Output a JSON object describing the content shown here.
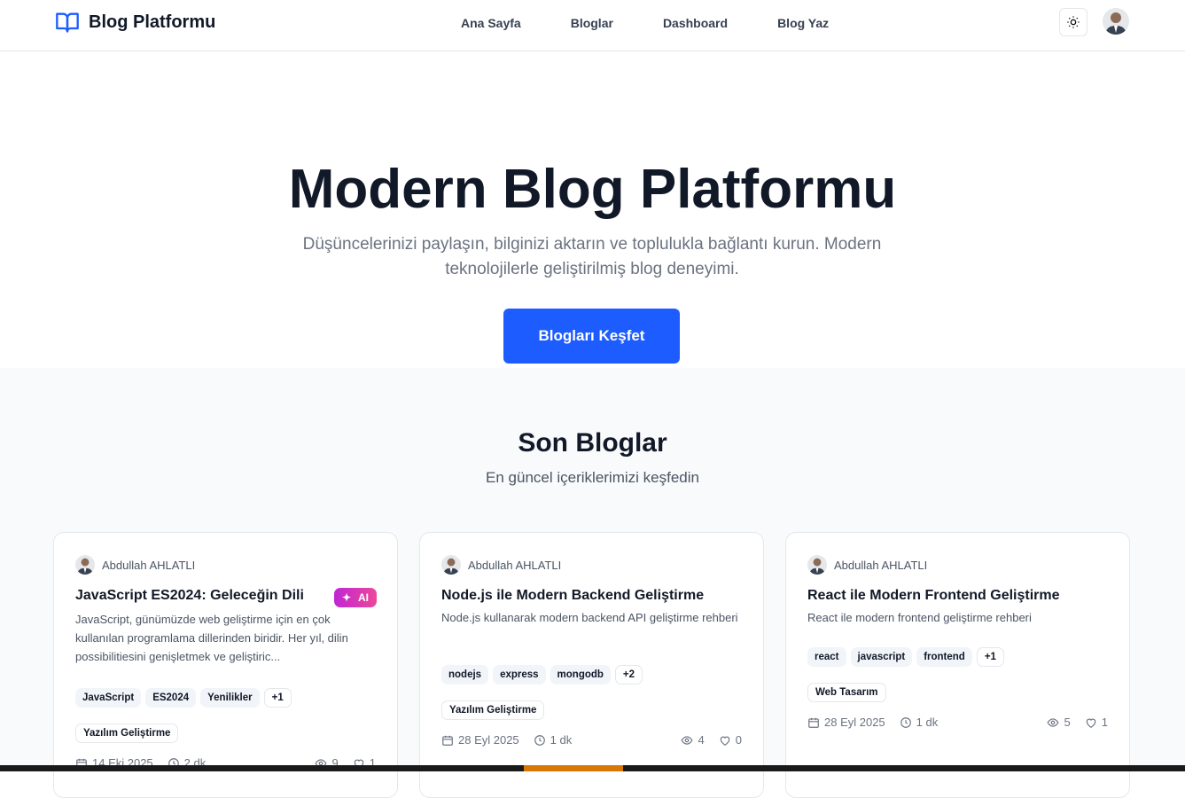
{
  "nav": {
    "brand": "Blog Platformu",
    "links": [
      "Ana Sayfa",
      "Bloglar",
      "Dashboard",
      "Blog Yaz"
    ]
  },
  "hero": {
    "title": "Modern Blog Platformu",
    "subtitle": "Düşüncelerinizi paylaşın, bilginizi aktarın ve toplulukla bağlantı kurun. Modern teknolojilerle geliştirilmiş blog deneyimi.",
    "cta": "Blogları Keşfet"
  },
  "section": {
    "title": "Son Bloglar",
    "subtitle": "En güncel içeriklerimizi keşfedin"
  },
  "posts": [
    {
      "author": "Abdullah AHLATLI",
      "title": "JavaScript ES2024: Geleceğin Dili",
      "badge": "AI",
      "excerpt": "JavaScript, günümüzde web geliştirme için en çok kullanılan programlama dillerinden biridir. Her yıl, dilin possibilitiesini genişletmek ve geliştiric...",
      "tags": [
        "JavaScript",
        "ES2024",
        "Yenilikler"
      ],
      "more": "+1",
      "category": "Yazılım Geliştirme",
      "date": "14 Eki 2025",
      "read": "2 dk",
      "views": "9",
      "likes": "1"
    },
    {
      "author": "Abdullah AHLATLI",
      "title": "Node.js ile Modern Backend Geliştirme",
      "excerpt": "Node.js kullanarak modern backend API geliştirme rehberi",
      "tags": [
        "nodejs",
        "express",
        "mongodb"
      ],
      "more": "+2",
      "category": "Yazılım Geliştirme",
      "date": "28 Eyl 2025",
      "read": "1 dk",
      "views": "4",
      "likes": "0"
    },
    {
      "author": "Abdullah AHLATLI",
      "title": "React ile Modern Frontend Geliştirme",
      "excerpt": "React ile modern frontend geliştirme rehberi",
      "tags": [
        "react",
        "javascript",
        "frontend"
      ],
      "more": "+1",
      "category": "Web Tasarım",
      "date": "28 Eyl 2025",
      "read": "1 dk",
      "views": "5",
      "likes": "1"
    }
  ]
}
